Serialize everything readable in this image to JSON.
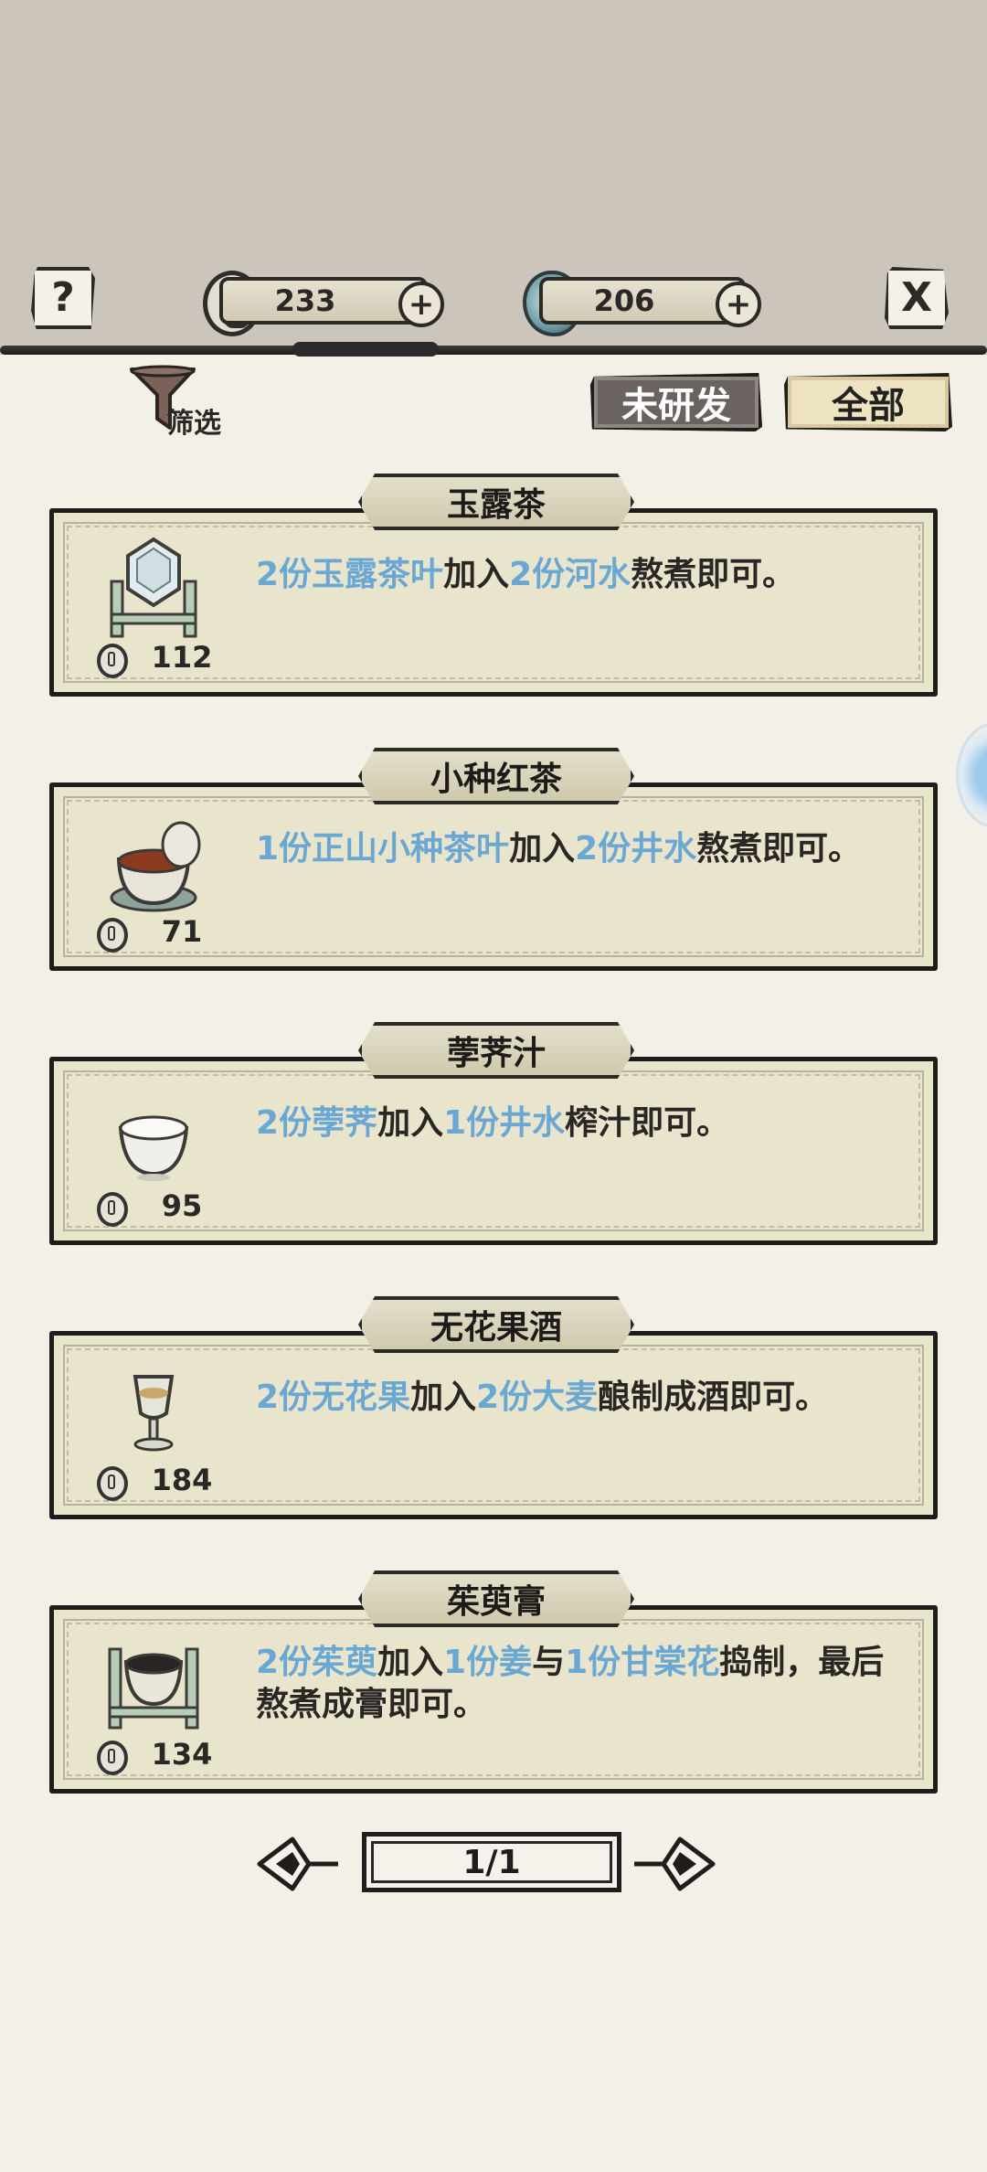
{
  "header": {
    "help_glyph": "?",
    "close_glyph": "X",
    "coins": {
      "value": "233",
      "icon": "coin-icon",
      "add_glyph": "+"
    },
    "jade": {
      "value": "206",
      "icon": "jade-icon",
      "add_glyph": "+"
    }
  },
  "filter": {
    "label": "筛选",
    "icon": "funnel-icon"
  },
  "tabs": {
    "undeveloped": "未研发",
    "all": "全部"
  },
  "recipes": [
    {
      "name": "玉露茶",
      "price": "112",
      "icon": "teapot-icon",
      "parts": [
        "2份玉露茶叶",
        "加入",
        "2份河水",
        "熬煮即可。"
      ]
    },
    {
      "name": "小种红茶",
      "price": "71",
      "icon": "tea-cup-icon",
      "parts": [
        "1份正山小种茶叶",
        "加入",
        "2份井水",
        "熬煮即可。"
      ]
    },
    {
      "name": "荸荠汁",
      "price": "95",
      "icon": "bowl-icon",
      "parts": [
        "2份荸荠",
        "加入",
        "1份井水",
        "榨汁即可。"
      ]
    },
    {
      "name": "无花果酒",
      "price": "184",
      "icon": "wine-glass-icon",
      "parts": [
        "2份无花果",
        "加入",
        "2份大麦",
        "酿制成酒即可。"
      ]
    },
    {
      "name": "茱萸膏",
      "price": "134",
      "icon": "paste-bowl-icon",
      "parts": [
        "2份茱萸",
        "加入",
        "1份姜",
        "与",
        "1份甘棠花",
        "捣制，最后熬煮成膏即可。"
      ]
    }
  ],
  "pager": {
    "label": "1/1"
  },
  "colors": {
    "highlight": "#6aa8d3",
    "text": "#2a2623",
    "background": "#f3f0e7",
    "top_band": "#ccc5bc"
  }
}
